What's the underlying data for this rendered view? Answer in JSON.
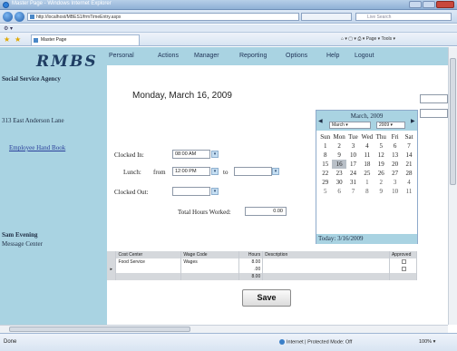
{
  "window": {
    "title": "Master Page - Windows Internet Explorer",
    "address": "http://localhost/MBES1/frmTimeEntry.aspx",
    "search_placeholder": "Live Search",
    "tab_title": "Master Page",
    "commands": "Page ▾  Tools ▾"
  },
  "sidebar": {
    "logo": "RMBS",
    "agency": "Social Service Agency",
    "address": "313 East Anderson Lane",
    "handbook_link": "Employee Hand Book",
    "user_name": "Sam Evening",
    "message_center": "Message Center"
  },
  "nav": {
    "items": [
      "Personal",
      "Actions",
      "Manager",
      "Reporting",
      "Options",
      "Help",
      "Logout"
    ]
  },
  "form": {
    "date_heading": "Monday, March 16, 2009",
    "clocked_in_label": "Clocked In:",
    "clocked_in_value": "08:00 AM",
    "lunch_label": "Lunch:",
    "from_label": "from",
    "lunch_from_value": "12:00 PM",
    "to_label": "to",
    "lunch_to_value": "",
    "clocked_out_label": "Clocked Out:",
    "clocked_out_value": "",
    "total_hours_label": "Total Hours Worked:",
    "total_hours_value": "0.00",
    "save_label": "Save"
  },
  "calendar": {
    "title": "March, 2009",
    "month_select": "March",
    "year_select": "2009",
    "days_of_week": [
      "Sun",
      "Mon",
      "Tue",
      "Wed",
      "Thu",
      "Fri",
      "Sat"
    ],
    "weeks": [
      [
        "1",
        "2",
        "3",
        "4",
        "5",
        "6",
        "7"
      ],
      [
        "8",
        "9",
        "10",
        "11",
        "12",
        "13",
        "14"
      ],
      [
        "15",
        "16",
        "17",
        "18",
        "19",
        "20",
        "21"
      ],
      [
        "22",
        "23",
        "24",
        "25",
        "26",
        "27",
        "28"
      ],
      [
        "29",
        "30",
        "31",
        "1",
        "2",
        "3",
        "4"
      ],
      [
        "5",
        "6",
        "7",
        "8",
        "9",
        "10",
        "11"
      ]
    ],
    "today_text": "Today: 3/16/2009"
  },
  "grid": {
    "headers": [
      "Cost Center",
      "Wage Code",
      "Hours",
      "Description",
      "Approved"
    ],
    "row1": {
      "cost_center": "Food Service",
      "wage_code": "Wages",
      "hours": "8.00",
      "description": ""
    },
    "row2": {
      "cost_center": "",
      "wage_code": "",
      "hours": ".00",
      "description": ""
    },
    "footer_total": "8.00"
  },
  "status": {
    "left": "Done",
    "zone": "Internet | Protected Mode: Off",
    "zoom": "100% ▾"
  }
}
